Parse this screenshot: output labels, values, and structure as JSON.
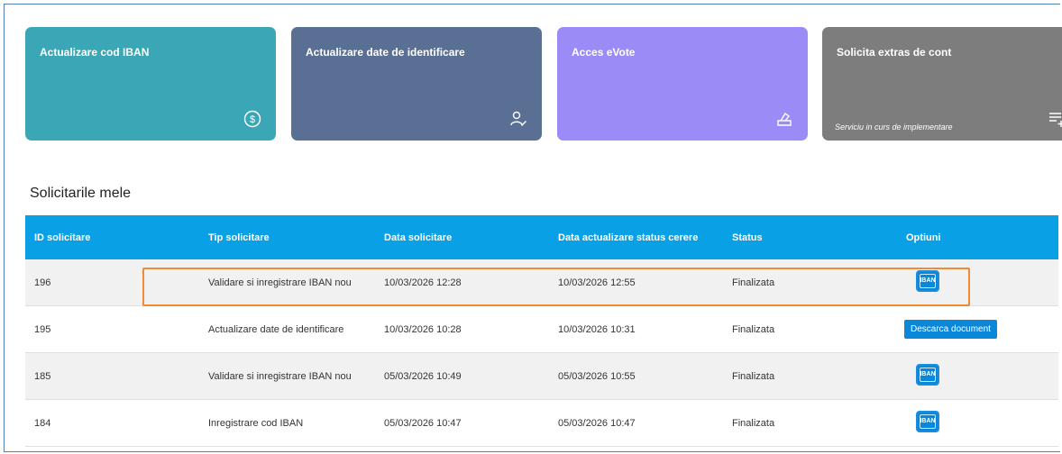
{
  "cards": [
    {
      "title": "Actualizare cod IBAN",
      "color": "#3ba6b5",
      "icon": "dollar-circle-icon"
    },
    {
      "title": "Actualizare date de identificare",
      "color": "#5a6f94",
      "icon": "user-edit-icon"
    },
    {
      "title": "Acces eVote",
      "color": "#9b8bf7",
      "icon": "vote-box-icon"
    },
    {
      "title": "Solicita extras de cont",
      "color": "#7d7d7d",
      "icon": "add-list-icon",
      "note": "Serviciu in curs de implementare"
    }
  ],
  "section_title": "Solicitarile mele",
  "table": {
    "headers": [
      "ID solicitare",
      "Tip solicitare",
      "Data solicitare",
      "Data actualizare status cerere",
      "Status",
      "Optiuni"
    ],
    "rows": [
      {
        "id": "196",
        "type": "Validare si inregistrare IBAN nou",
        "date": "10/03/2026 12:28",
        "updated": "10/03/2026 12:55",
        "status": "Finalizata",
        "option": "iban"
      },
      {
        "id": "195",
        "type": "Actualizare date de identificare",
        "date": "10/03/2026 10:28",
        "updated": "10/03/2026 10:31",
        "status": "Finalizata",
        "option": "Descarca document"
      },
      {
        "id": "185",
        "type": "Validare si inregistrare IBAN nou",
        "date": "05/03/2026 10:49",
        "updated": "05/03/2026 10:55",
        "status": "Finalizata",
        "option": "iban"
      },
      {
        "id": "184",
        "type": "Inregistrare cod IBAN",
        "date": "05/03/2026 10:47",
        "updated": "05/03/2026 10:47",
        "status": "Finalizata",
        "option": "iban"
      }
    ],
    "iban_label": "IBAN"
  },
  "highlight_color": "#f08a37",
  "header_color": "#0aa0e6"
}
